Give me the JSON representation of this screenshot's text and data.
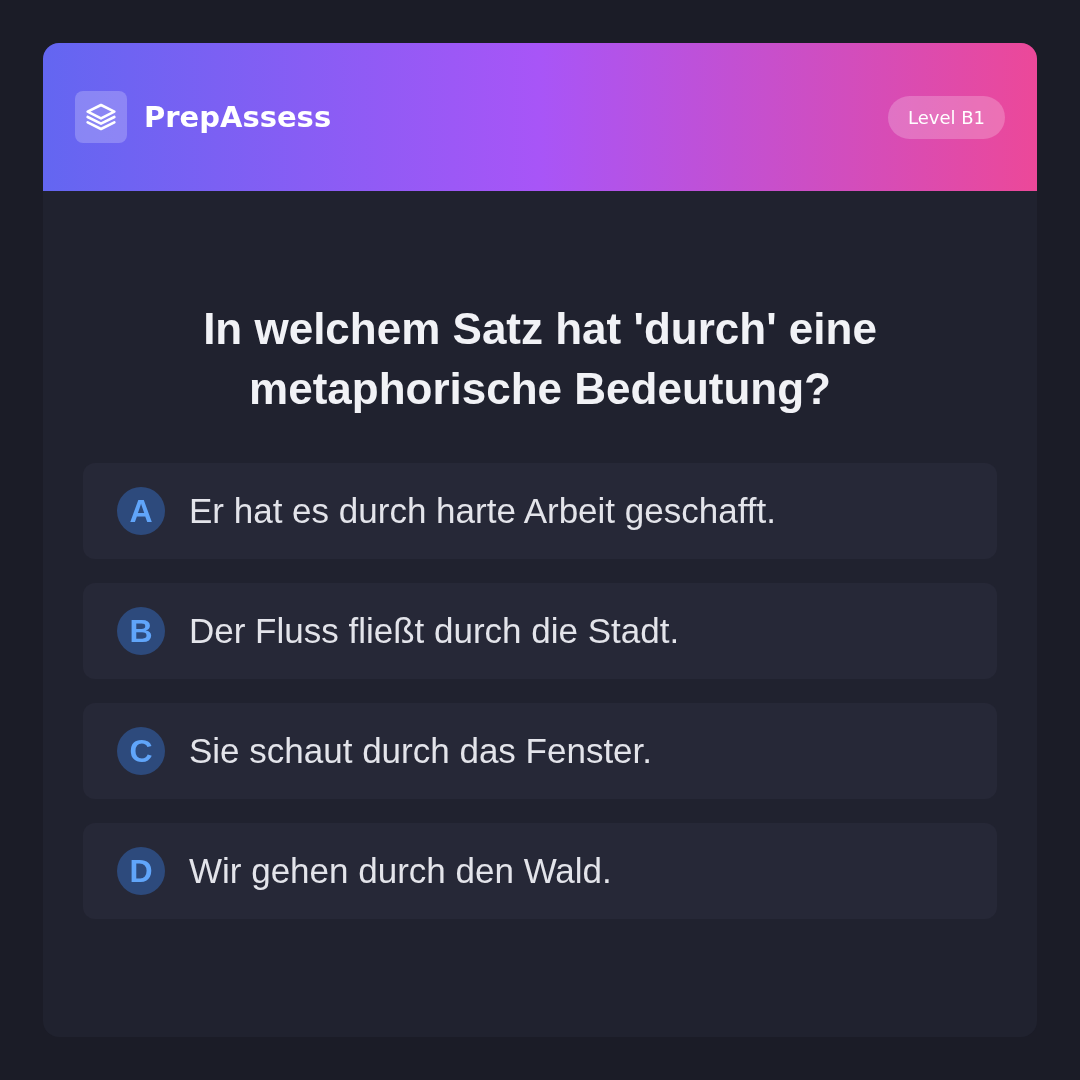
{
  "header": {
    "brand": "PrepAssess",
    "badge": "Level B1"
  },
  "question": "In welchem Satz hat 'durch' eine metaphorische Bedeutung?",
  "options": [
    {
      "letter": "A",
      "text": "Er hat es durch harte Arbeit geschafft.",
      "selected": false
    },
    {
      "letter": "B",
      "text": "Der Fluss fließt durch die Stadt.",
      "selected": false
    },
    {
      "letter": "C",
      "text": "Sie schaut durch das Fenster.",
      "selected": false
    },
    {
      "letter": "D",
      "text": "Wir gehen durch den Wald.",
      "selected": false
    }
  ]
}
